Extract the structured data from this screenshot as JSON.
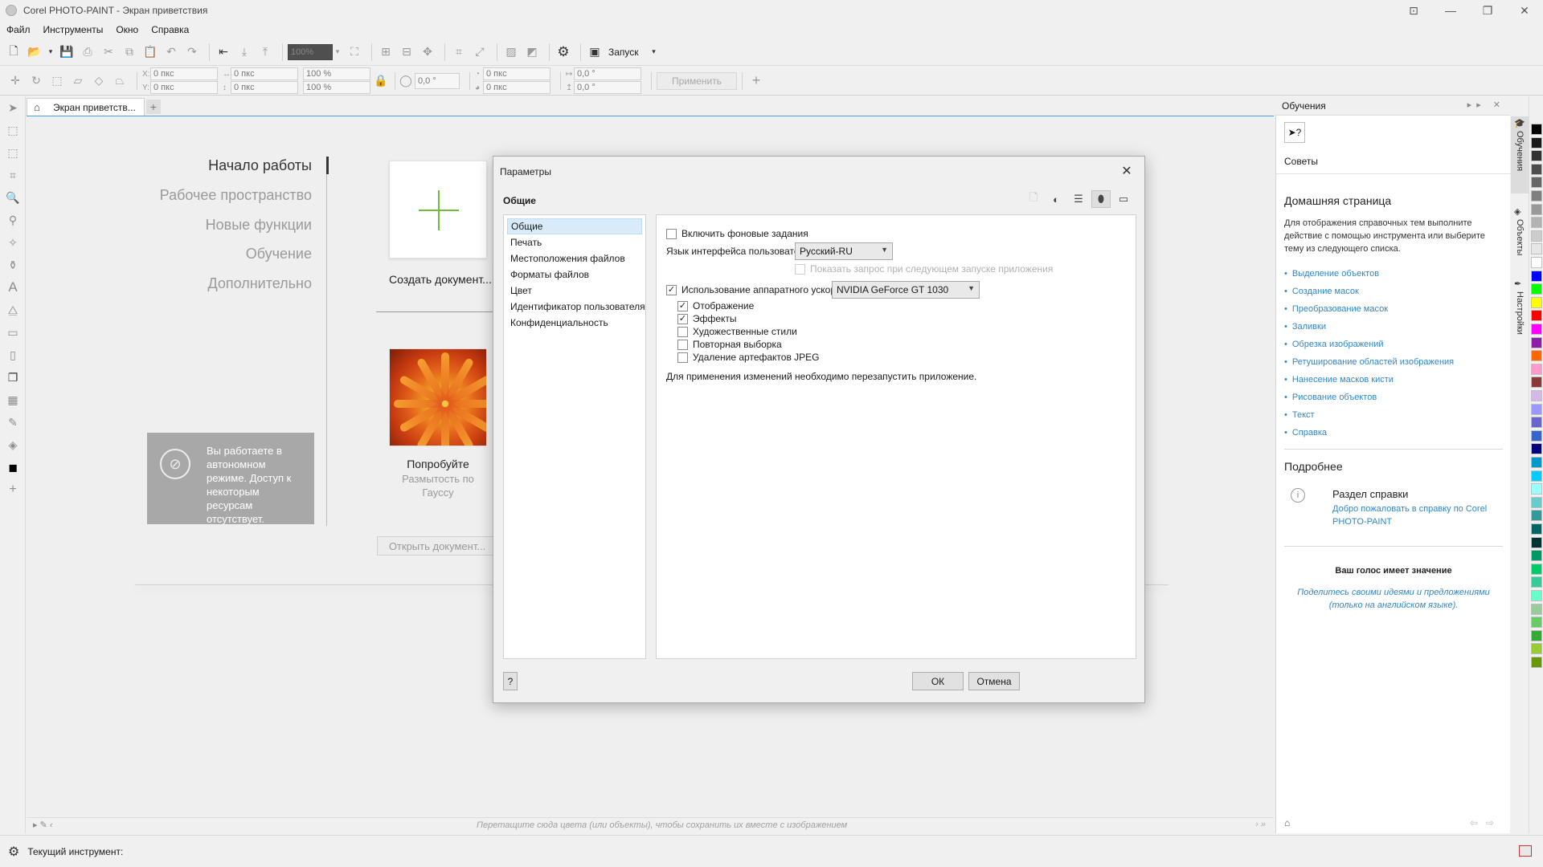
{
  "window": {
    "title": "Corel PHOTO-PAINT - Экран приветствия"
  },
  "menu": [
    "Файл",
    "Инструменты",
    "Окно",
    "Справка"
  ],
  "toolbar": {
    "zoom_value": "100%",
    "launch_label": "Запуск"
  },
  "property_bar": {
    "x": "0 пкс",
    "y": "0 пкс",
    "width": "0 пкс",
    "height": "0 пкс",
    "scale_x": "100 %",
    "scale_y": "100 %",
    "rotation": "0,0 °",
    "center_x": "0 пкс",
    "center_y": "0 пкс",
    "skew_x": "0,0 °",
    "skew_y": "0,0 °",
    "apply_label": "Применить",
    "label_x": "X:",
    "label_y": "Y:"
  },
  "doc_tab": {
    "label": "Экран приветств..."
  },
  "welcome": {
    "nav": [
      "Начало работы",
      "Рабочее пространство",
      "Новые функции",
      "Обучение",
      "Дополнительно"
    ],
    "offline_message": "Вы работаете в автономном режиме. Доступ к некоторым ресурсам отсутствует.",
    "create_label": "Создать документ...",
    "try_label": "Попробуйте",
    "try_subtitle": "Размытость по Гауссу",
    "open_label": "Открыть документ..."
  },
  "palette_hint": "Перетащите сюда цвета (или объекты), чтобы сохранить их вместе с изображением",
  "status": {
    "current_tool": "Текущий инструмент:"
  },
  "docker": {
    "title": "Обучения",
    "tips_label": "Советы",
    "home_heading": "Домашняя страница",
    "home_desc": "Для отображения справочных тем выполните действие с помощью инструмента или выберите тему из следующего списка.",
    "links": [
      "Выделение объектов",
      "Создание масок",
      "Преобразование масок",
      "Заливки",
      "Обрезка изображений",
      "Ретуширование областей изображения",
      "Нанесение масков кисти",
      "Рисование объектов",
      "Текст",
      "Справка"
    ],
    "more_heading": "Подробнее",
    "help_title": "Раздел справки",
    "help_link": "Добро пожаловать в справку по Corel PHOTO-PAINT",
    "vote_title": "Ваш голос имеет значение",
    "vote_text": "Поделитесь своими идеями и предложениями (только на английском языке)."
  },
  "vertical_tabs": [
    "Обучения",
    "Объекты",
    "Настройки"
  ],
  "palette_colors": [
    "#000000",
    "#1a1a1a",
    "#333333",
    "#4d4d4d",
    "#666666",
    "#808080",
    "#999999",
    "#b3b3b3",
    "#cccccc",
    "#e6e6e6",
    "#ffffff",
    "#0000ff",
    "#00ff00",
    "#ffff00",
    "#ff0000",
    "#ff00ff",
    "#8b1fa8",
    "#ff6600",
    "#ff99cc",
    "#8b3a3a",
    "#d4b8e8",
    "#9999ff",
    "#6666cc",
    "#3366cc",
    "#000080",
    "#0099cc",
    "#00ccff",
    "#99ffff",
    "#66cccc",
    "#339999",
    "#006666",
    "#003333",
    "#009966",
    "#00cc66",
    "#33cc99",
    "#66ffcc",
    "#99cc99",
    "#66cc66",
    "#33aa33",
    "#99cc33",
    "#669900"
  ],
  "dialog": {
    "title": "Параметры",
    "section": "Общие",
    "tree": [
      "Общие",
      "Печать",
      "Местоположения файлов",
      "Форматы файлов",
      "Цвет",
      "Идентификатор пользователя",
      "Конфиденциальность"
    ],
    "bg_tasks": "Включить фоновые задания",
    "ui_lang_label": "Язык интерфейса пользователя:",
    "ui_lang_value": "Русский-RU",
    "ask_next_start": "Показать запрос при следующем запуске приложения",
    "hw_accel": "Использование аппаратного ускорения:",
    "gpu_value": "NVIDIA GeForce GT 1030",
    "opt_display": "Отображение",
    "opt_effects": "Эффекты",
    "opt_art_styles": "Художественные стили",
    "opt_reselect": "Повторная выборка",
    "opt_jpeg": "Удаление артефактов JPEG",
    "restart_note": "Для применения изменений необходимо перезапустить приложение.",
    "help_btn": "?",
    "ok": "ОК",
    "cancel": "Отмена",
    "checks": {
      "bg_tasks": false,
      "ask_next_start": false,
      "hw_accel": true,
      "display": true,
      "effects": true,
      "art_styles": false,
      "reselect": false,
      "jpeg": false
    }
  }
}
